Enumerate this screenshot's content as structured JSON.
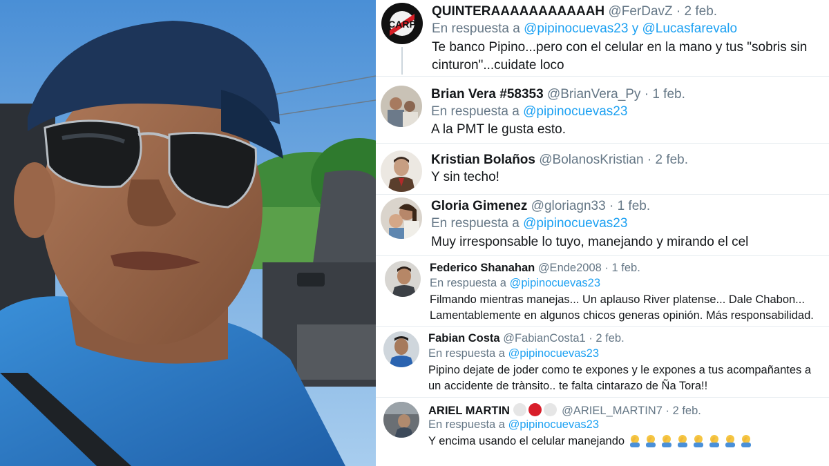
{
  "tweets": [
    {
      "name": "QUINTERAAAAAAAAAAAH",
      "handle": "@FerDavZ",
      "date": "2 feb.",
      "reply_prefix": "En respuesta a",
      "reply_mention_1": "@pipinocuevas23",
      "reply_conj": "y",
      "reply_mention_2": "@Lucasfarevalo",
      "text": "Te banco Pipino...pero con el celular en la mano y tus \"sobris sin cinturon\"...cuidate loco"
    },
    {
      "name": "Brian Vera #58353",
      "handle": "@BrianVera_Py",
      "date": "1 feb.",
      "reply_prefix": "En respuesta a",
      "reply_mention_1": "@pipinocuevas23",
      "text": "A la PMT le gusta esto."
    },
    {
      "name": "Kristian Bolaños",
      "handle": "@BolanosKristian",
      "date": "2 feb.",
      "text": "Y sin techo!"
    },
    {
      "name": "Gloria Gimenez",
      "handle": "@gloriagn33",
      "date": "1 feb.",
      "reply_prefix": "En respuesta a",
      "reply_mention_1": "@pipinocuevas23",
      "text": "Muy irresponsable lo tuyo, manejando y mirando el cel"
    },
    {
      "name": "Federico Shanahan",
      "handle": "@Ende2008",
      "date": "1 feb.",
      "reply_prefix": "En respuesta a",
      "reply_mention_1": "@pipinocuevas23",
      "text": "Filmando mientras manejas... Un aplauso River platense... Dale Chabon... Lamentablemente en algunos chicos generas opinión. Más responsabilidad."
    },
    {
      "name": "Fabian Costa",
      "handle": "@FabianCosta1",
      "date": "2 feb.",
      "reply_prefix": "En respuesta a",
      "reply_mention_1": "@pipinocuevas23",
      "text": "Pipino dejate de joder como te expones y le expones a tus acompañantes a un accidente de trànsito.. te falta cintarazo de Ña Tora!!"
    },
    {
      "name": "ARIEL MARTIN",
      "handle": "@ARIEL_MARTIN7",
      "date": "2 feb.",
      "reply_prefix": "En respuesta a",
      "reply_mention_1": "@pipinocuevas23",
      "text": "Y encima usando el celular manejando"
    }
  ],
  "separator_dot": "·",
  "colors": {
    "link": "#1da1f2",
    "secondary_text": "#657786",
    "primary_text": "#14171a",
    "divider": "#e6ecf0"
  },
  "icons": {
    "name_emoji": [
      "white-circle",
      "red-circle",
      "white-circle"
    ],
    "text_emoji": [
      "facepalm",
      "facepalm",
      "facepalm",
      "facepalm",
      "facepalm",
      "facepalm",
      "facepalm",
      "facepalm"
    ]
  }
}
